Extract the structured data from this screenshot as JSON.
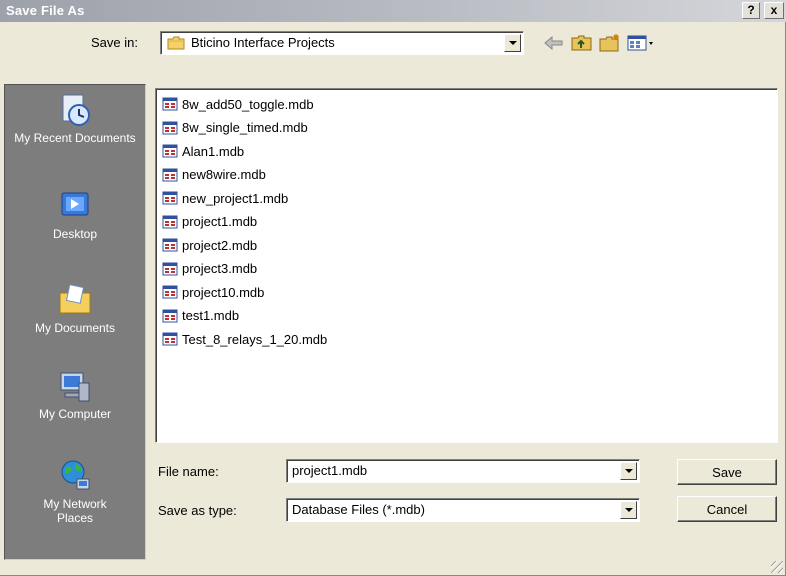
{
  "window": {
    "title": "Save File As",
    "help_label": "?",
    "close_label": "x"
  },
  "save_in": {
    "label": "Save in:",
    "value": "Bticino Interface Projects"
  },
  "places": [
    {
      "label": "My Recent Documents",
      "icon": "recent-documents-icon"
    },
    {
      "label": "Desktop",
      "icon": "desktop-icon"
    },
    {
      "label": "My Documents",
      "icon": "my-documents-icon"
    },
    {
      "label": "My Computer",
      "icon": "my-computer-icon"
    },
    {
      "label": "My Network Places",
      "icon": "network-places-icon"
    }
  ],
  "files": [
    "8w_add50_toggle.mdb",
    "8w_single_timed.mdb",
    "Alan1.mdb",
    "new8wire.mdb",
    "new_project1.mdb",
    "project1.mdb",
    "project2.mdb",
    "project3.mdb",
    "project10.mdb",
    "test1.mdb",
    "Test_8_relays_1_20.mdb"
  ],
  "file_name": {
    "label": "File name:",
    "value": "project1.mdb"
  },
  "save_as_type": {
    "label": "Save as type:",
    "value": "Database Files (*.mdb)"
  },
  "buttons": {
    "save": "Save",
    "cancel": "Cancel"
  },
  "colors": {
    "places_bg": "#7d7d7d",
    "dialog_bg": "#ece9d8",
    "title_text": "#ffffff"
  }
}
